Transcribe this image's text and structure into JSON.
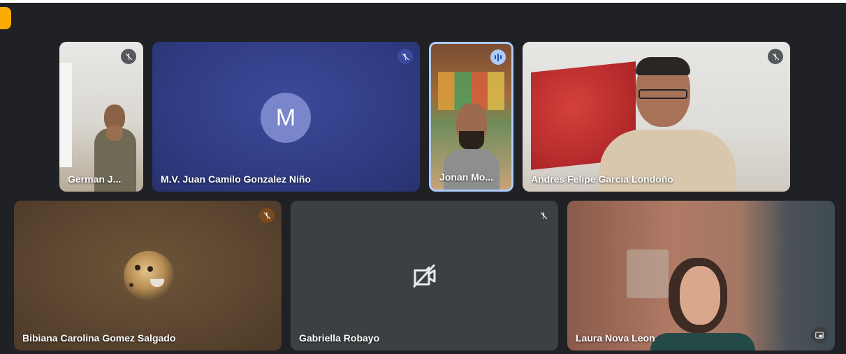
{
  "colors": {
    "background": "#202124",
    "accent_tab": "#f9ab00",
    "avatar_m": "#7986cb",
    "speaking_badge": "#aecbfa"
  },
  "tiles": [
    {
      "name": "German J...",
      "status_icon": "mic-off-icon"
    },
    {
      "name": "M.V. Juan Camilo Gonzalez Niño",
      "avatar_initial": "M",
      "status_icon": "mic-off-icon"
    },
    {
      "name": "Jonan Mo...",
      "status_icon": "speaking-indicator-icon"
    },
    {
      "name": "Andres Felipe Garcia Londoño",
      "status_icon": "mic-off-icon"
    },
    {
      "name": "Bibiana Carolina Gomez Salgado",
      "status_icon": "mic-off-icon",
      "avatar": "ocelot-photo"
    },
    {
      "name": "Gabriella Robayo",
      "status_icon": "mic-off-icon",
      "video_state": "camera-off-icon"
    },
    {
      "name": "Laura Nova Leon",
      "corner_icon": "picture-in-picture-icon"
    }
  ]
}
